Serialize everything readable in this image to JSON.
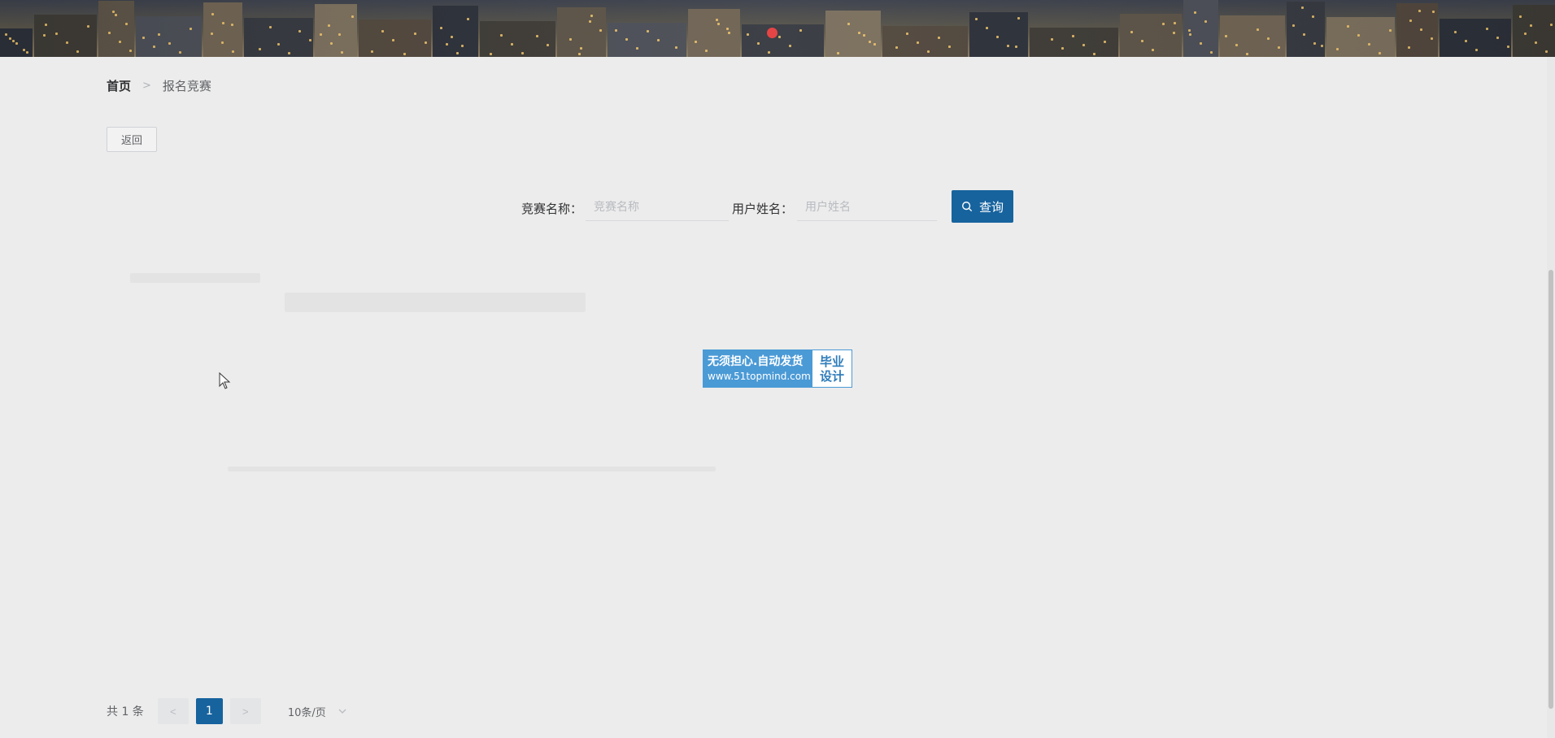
{
  "banner": {
    "icon": "city-skyline-banner",
    "dot_color": "#e64545"
  },
  "breadcrumb": {
    "home": "首页",
    "separator": ">",
    "current": "报名竞赛"
  },
  "back_button": {
    "label": "返回"
  },
  "search": {
    "competition_label": "竞赛名称：",
    "competition_placeholder": "竞赛名称",
    "competition_value": "",
    "user_label": "用户姓名：",
    "user_placeholder": "用户姓名",
    "user_value": "",
    "button_label": "查询",
    "button_icon": "search-icon"
  },
  "watermark": {
    "line1": "无须担心.自动发货",
    "line2": "www.51topmind.com",
    "right_line1": "毕业",
    "right_line2": "设计"
  },
  "pagination": {
    "total": "共 1 条",
    "prev": "<",
    "current_page": "1",
    "next": ">",
    "page_size": "10条/页"
  },
  "colors": {
    "primary": "#16639e",
    "background": "#ececec",
    "watermark": "#4a9ad6"
  }
}
